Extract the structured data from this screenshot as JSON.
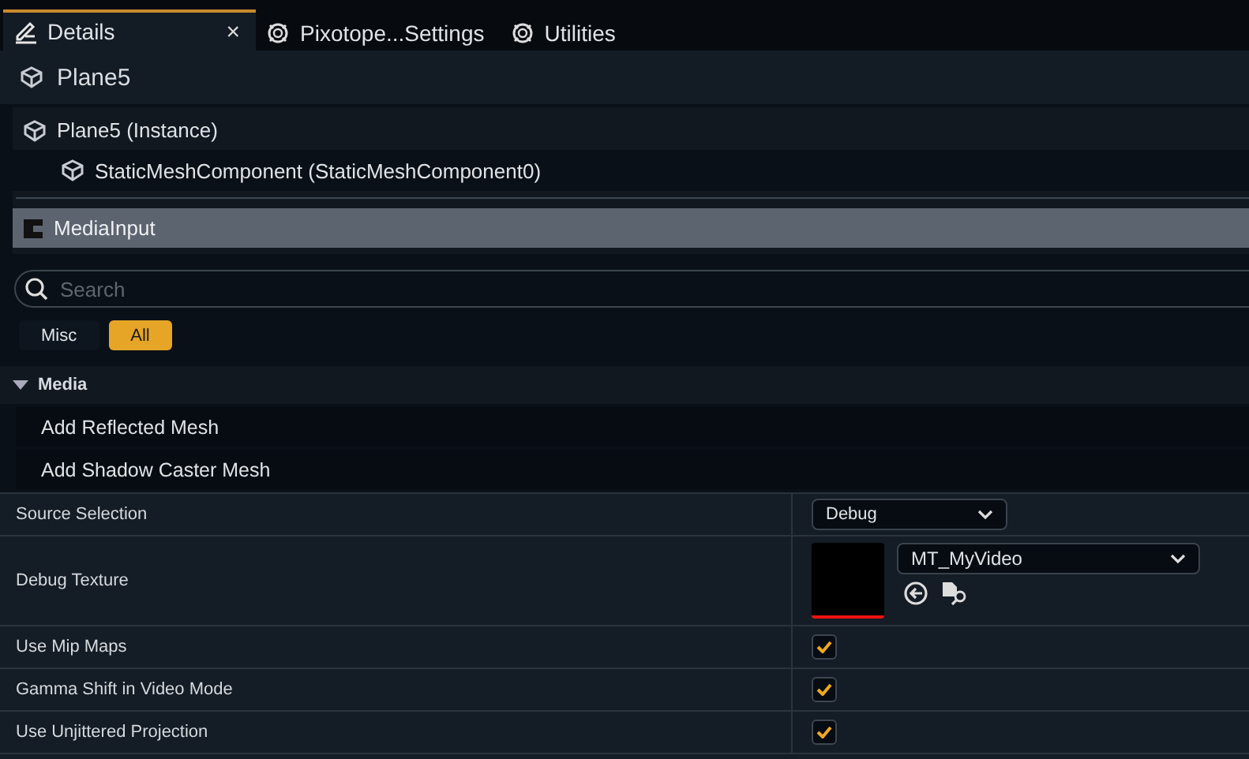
{
  "tabs": [
    {
      "label": "Details",
      "kind": "details",
      "selected": true,
      "close": "×"
    },
    {
      "label": "Pixotope...Settings",
      "kind": "plugin",
      "selected": false
    },
    {
      "label": "Utilities",
      "kind": "plugin",
      "selected": false
    }
  ],
  "actor": {
    "title": "Plane5"
  },
  "components": [
    {
      "label": "Plane5 (Instance)",
      "kind": "mesh",
      "selected": false,
      "children": [
        {
          "label": "StaticMeshComponent (StaticMeshComponent0)",
          "kind": "mesh",
          "selected": false
        }
      ]
    },
    {
      "label": "MediaInput",
      "kind": "class",
      "selected": true
    }
  ],
  "search": {
    "placeholder": "Search"
  },
  "filters": [
    {
      "label": "Misc",
      "selected": false
    },
    {
      "label": "All",
      "selected": true
    }
  ],
  "section": {
    "title": "Media",
    "expanded": true
  },
  "actions": [
    "Add Reflected Mesh",
    "Add Shadow Caster Mesh"
  ],
  "properties": [
    {
      "name": "Source Selection",
      "kind": "dropdown",
      "value": "Debug"
    },
    {
      "name": "Debug Texture",
      "kind": "asset",
      "value": "MT_MyVideo"
    },
    {
      "name": "Use Mip Maps",
      "kind": "checkbox",
      "checked": true
    },
    {
      "name": "Gamma Shift in Video Mode",
      "kind": "checkbox",
      "checked": true
    },
    {
      "name": "Use Unjittered Projection",
      "kind": "checkbox",
      "checked": true
    }
  ]
}
